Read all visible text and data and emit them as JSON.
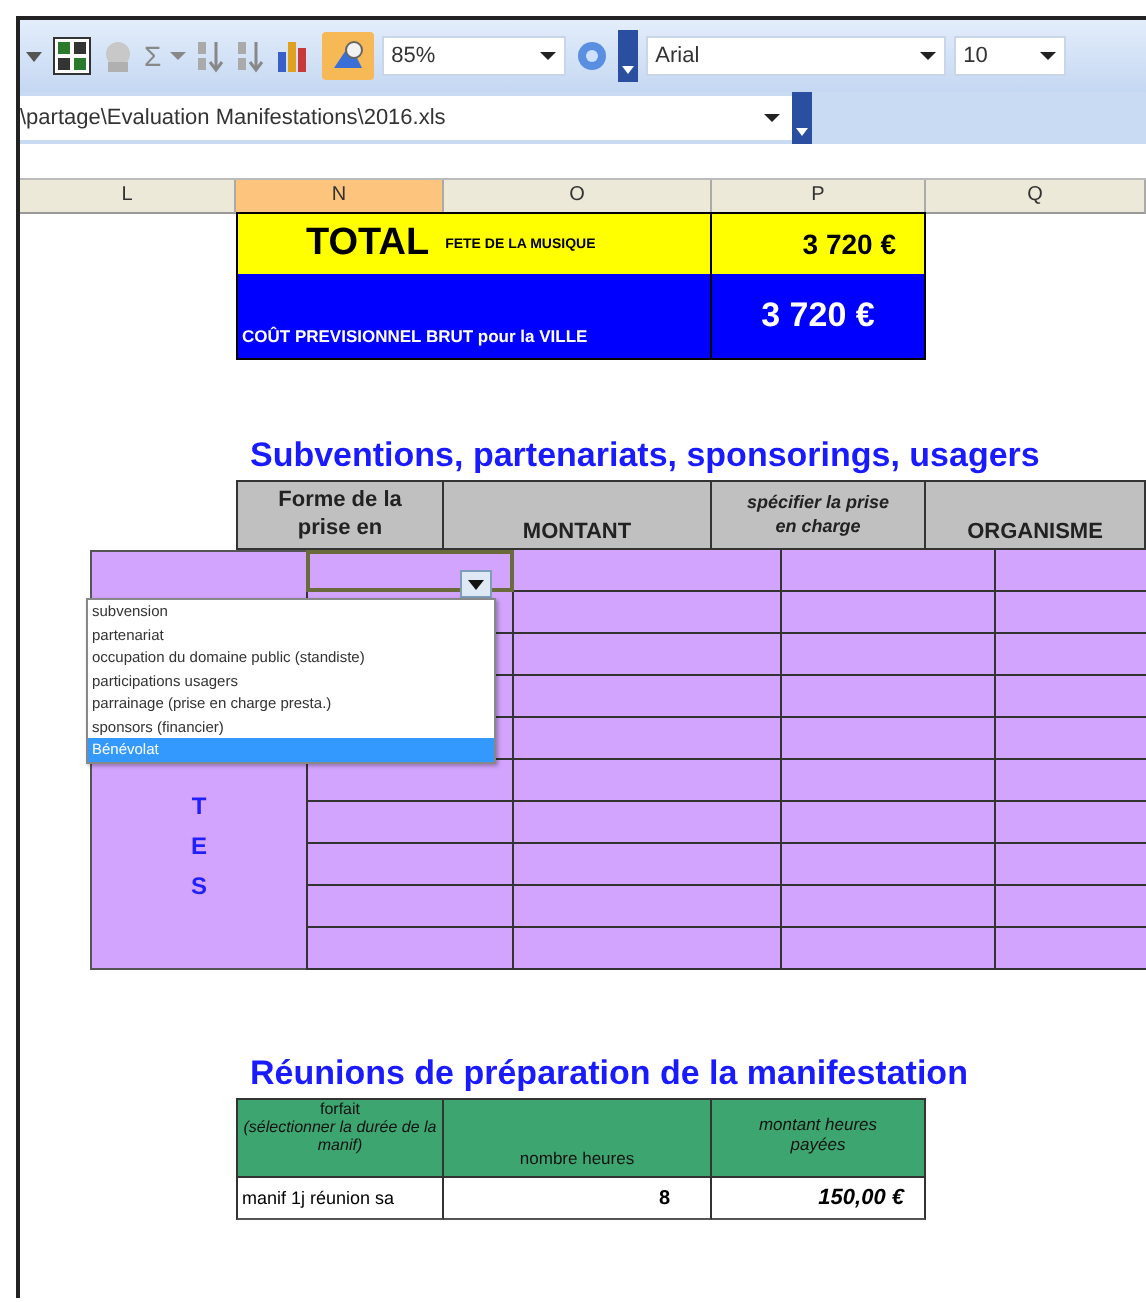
{
  "toolbar": {
    "sum_symbol": "Σ",
    "zoom": "85%",
    "font": "Arial",
    "font_size": "10"
  },
  "address_bar": {
    "path": "\\partage\\Evaluation Manifestations\\2016.xls"
  },
  "columns": [
    {
      "label": "L",
      "selected": false
    },
    {
      "label": "N",
      "selected": true
    },
    {
      "label": "O",
      "selected": false
    },
    {
      "label": "P",
      "selected": false
    },
    {
      "label": "Q",
      "selected": false
    }
  ],
  "total": {
    "label": "TOTAL",
    "event": "FETE DE LA MUSIQUE",
    "amount": "3 720 €"
  },
  "cost": {
    "label": "COÛT PREVISIONNEL BRUT pour la VILLE",
    "amount": "3 720 €"
  },
  "subsidies": {
    "title": "Subventions, partenariats, sponsorings, usagers",
    "headers": [
      "Forme de la\nprise en",
      "MONTANT",
      "spécifier la prise\nen charge",
      "ORGANISME"
    ],
    "side_letters": [
      "T",
      "E",
      "S"
    ]
  },
  "dropdown": {
    "options": [
      {
        "label": "subvension",
        "selected": false
      },
      {
        "label": "partenariat",
        "selected": false
      },
      {
        "label": "occupation du domaine public (standiste)",
        "selected": false
      },
      {
        "label": "participations usagers",
        "selected": false
      },
      {
        "label": "parrainage (prise en charge presta.)",
        "selected": false
      },
      {
        "label": "sponsors (financier)",
        "selected": false
      },
      {
        "label": "Bénévolat",
        "selected": true
      }
    ]
  },
  "meetings": {
    "title": "Réunions de préparation de la manifestation",
    "headers": [
      {
        "title": "forfait",
        "note": "(sélectionner la durée de la manif)"
      },
      {
        "title": "nombre heures"
      },
      {
        "title": "montant heures\npayées"
      }
    ],
    "rows": [
      [
        "manif 1j réunion sa",
        "8",
        "150,00 €"
      ]
    ]
  }
}
